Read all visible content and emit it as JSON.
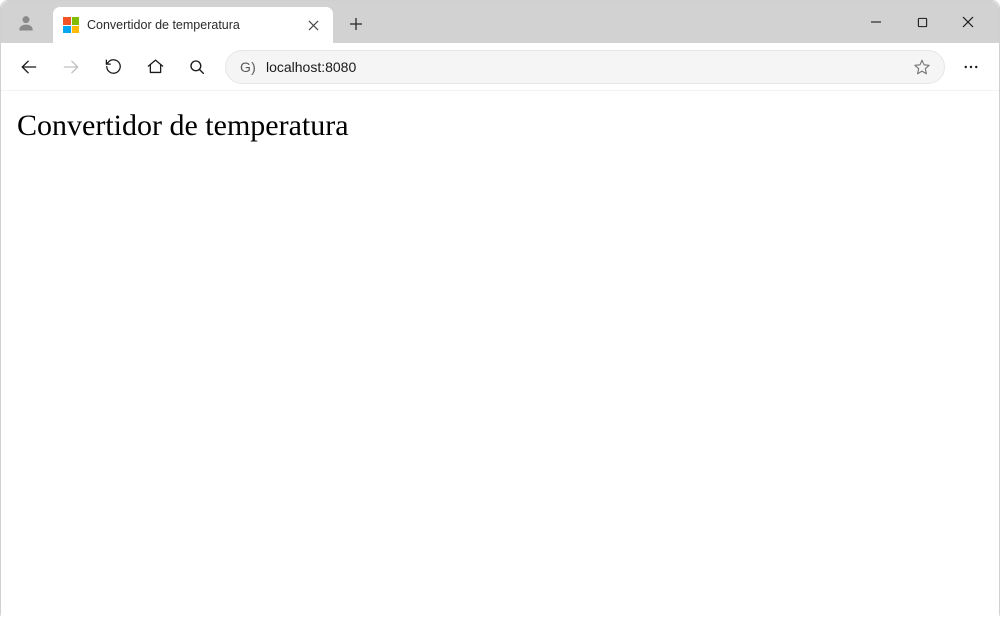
{
  "tab": {
    "title": "Convertidor de temperatura"
  },
  "address": {
    "prefix": "G)",
    "url": "localhost:8080"
  },
  "page": {
    "heading": "Convertidor de temperatura"
  }
}
